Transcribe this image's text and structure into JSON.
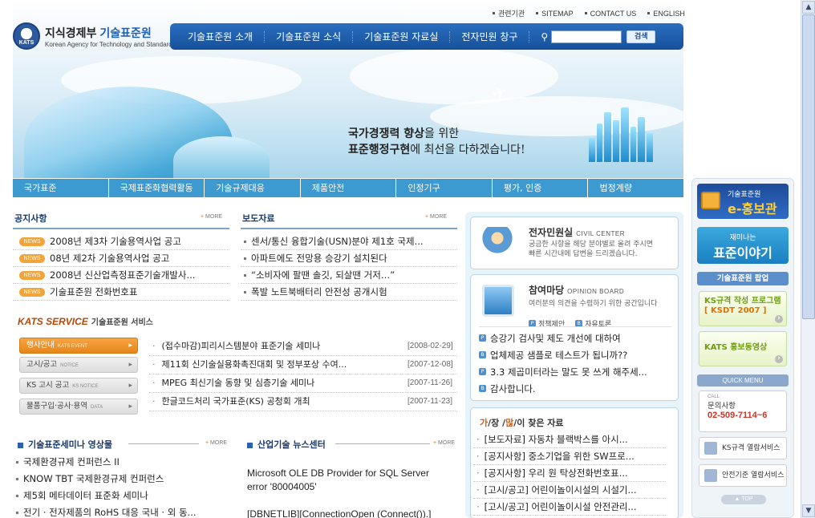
{
  "header": {
    "top_links": [
      "관련기관",
      "SITEMAP",
      "CONTACT US",
      "ENGLISH"
    ],
    "logo": {
      "seal": "KATS",
      "ministry": "지식경제부",
      "agency": "기술표준원",
      "english": "Korean Agency for Technology and Standards"
    },
    "gnb": [
      "기술표준원 소개",
      "기술표준원 소식",
      "기술표준원 자료실",
      "전자민원 창구"
    ],
    "search": {
      "button": "검색",
      "placeholder": ""
    },
    "slogan_line1_bold": "국가경쟁력 향상",
    "slogan_line1_rest": "을 위한",
    "slogan_line2_bold": "표준행정구현",
    "slogan_line2_rest": "에 최선을 다하겠습니다!"
  },
  "subnav": [
    "국가표준",
    "국제표준화협력활동",
    "기술규제대응",
    "제품안전",
    "인정기구",
    "평가, 인증",
    "법정계량"
  ],
  "notice": {
    "title": "공지사항",
    "more": "MORE",
    "badge": "NEWS",
    "items": [
      "2008년 제3차 기술용역사업 공고",
      "08년 제2차 기술용역사업 공고",
      "2008년 신산업측정표준기술개발사...",
      "기술표준원 전화번호표"
    ]
  },
  "press": {
    "title": "보도자료",
    "more": "MORE",
    "items": [
      "센서/통신 융합기술(USN)분야 제1호 국제...",
      "아파트에도 전망용 승강기 설치된다",
      "“소비자에 팔땐 솔깃, 되살땐 거저…”",
      "폭발 노트북배터리 안전성 공개시험"
    ]
  },
  "kats_service": {
    "title": "KATS SERVICE",
    "subtitle": "기술표준원 서비스",
    "buttons": [
      {
        "label": "행사안내",
        "en": "KATS EVENT"
      },
      {
        "label": "고시/공고",
        "en": "NOTICE"
      },
      {
        "label": "KS 고시 공고",
        "en": "KS NOTICE"
      },
      {
        "label": "물품구입·공사·용역",
        "en": "DATA"
      }
    ],
    "events": [
      {
        "title": "(접수마감)피리시스템분야 표준기술 세미나",
        "date": "[2008-02-29]"
      },
      {
        "title": "제11회 신기술실용화촉진대회 및 정부포상 수여...",
        "date": "[2007-12-08]"
      },
      {
        "title": "MPEG 최신기술 동향 및 심층기술 세미나",
        "date": "[2007-11-26]"
      },
      {
        "title": "한글코드처리 국가표준(KS) 공청회 개최",
        "date": "[2007-11-23]"
      }
    ]
  },
  "seminar": {
    "title": "기술표준세미나 영상물",
    "more": "MORE",
    "items": [
      "국제환경규제 컨퍼런스 II",
      "KNOW TBT 국제환경규제 컨퍼런스",
      "제5회 메타데이터 표준화 세미나",
      "전기 · 전자제품의 RoHS 대응 국내 · 외 동..."
    ]
  },
  "industry_news": {
    "title": "산업기술 뉴스센터",
    "more": "MORE",
    "error_line1": "Microsoft OLE DB Provider for SQL Server",
    "error_line2": "error '80004005'",
    "error_line3": "[DBNETLIB][ConnectionOpen (Connect()).]"
  },
  "civil_center": {
    "title": "전자민원실",
    "en": "CIVIL CENTER",
    "desc1": "궁금한 사항을 해당 분야별로 올려 주시면",
    "desc2": "빠른 시간내에 답변을 드리겠습니다."
  },
  "opinion_board": {
    "title": "참여마당",
    "en": "OPINION BOARD",
    "desc": "여러분의 의견을 수렴하기 위한 공간입니다",
    "tags": [
      "정책제안",
      "자유토론"
    ],
    "tag_icons": [
      "P",
      "B"
    ],
    "items": [
      "승강기 검사및 제도 개선에 대하여",
      "업체제공 샘플로 테스트가 됩니까??",
      "3.3 제곱미터라는 말도 못 쓰게 해주세...",
      "감사합니다."
    ],
    "item_icons": [
      "P",
      "B",
      "P",
      "B"
    ]
  },
  "faq": {
    "title_parts": [
      "가",
      "/장 /",
      "많",
      "/이",
      " 찾은 자료"
    ],
    "items": [
      "[보도자료] 자동차 블랙박스를 아시...",
      "[공지사항] 중소기업을 위한 SW프로...",
      "[공지사항] 우리 원 탁상전화번호표...",
      "[고시/공고] 어린이놀이시설의 시설기...",
      "[고시/공고] 어린이놀이시설 안전관리..."
    ]
  },
  "side": {
    "ebanner_small": "기술표준원",
    "ebanner_big": "e-홍보관",
    "story_small": "재미나는",
    "story_big": "표준이야기",
    "popup_title": "기술표준원 팝업",
    "popup1_line1": "KS규격 작성 프로그램",
    "popup1_line2": "[ KSDT 2007 ]",
    "popup2": "KATS 홍보동영상",
    "quick_menu": "QUICK MENU",
    "call_label": "CALL",
    "call_title": "문의사항",
    "call_number": "02-509-7114~6",
    "service1": "KS규격 열람서비스",
    "service2": "안전기준 열람서비스",
    "top": "▲ TOP"
  },
  "colors": {
    "brand_blue": "#16509a",
    "subnav": "#3c9ad1",
    "accent_orange": "#e6861b"
  }
}
